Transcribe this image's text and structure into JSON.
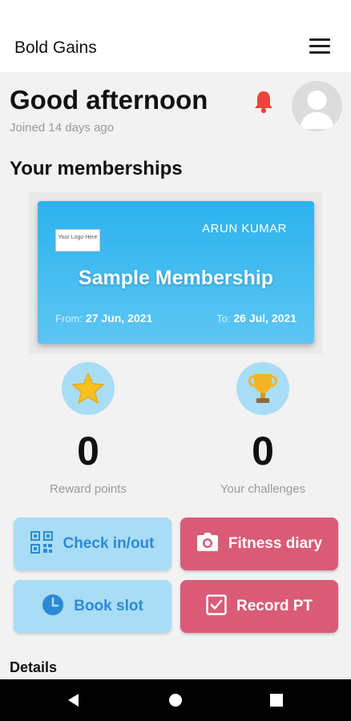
{
  "app": {
    "title": "Bold Gains"
  },
  "header": {
    "greeting": "Good afternoon",
    "joined": "Joined 14 days ago"
  },
  "memberships": {
    "section_title": "Your memberships",
    "card": {
      "logo_text": "Your Logo Here",
      "holder": "ARUN KUMAR",
      "plan": "Sample Membership",
      "from_label": "From:",
      "from_date": "27 Jun, 2021",
      "to_label": "To:",
      "to_date": "26 Jul, 2021"
    }
  },
  "stats": {
    "reward": {
      "value": "0",
      "label": "Reward points",
      "icon": "star-icon"
    },
    "challenges": {
      "value": "0",
      "label": "Your challenges",
      "icon": "trophy-icon"
    }
  },
  "actions": [
    {
      "label": "Check in/out",
      "icon": "qr-code-icon"
    },
    {
      "label": "Fitness diary",
      "icon": "camera-icon"
    },
    {
      "label": "Book slot",
      "icon": "clock-icon"
    },
    {
      "label": "Record PT",
      "icon": "checkbox-icon"
    }
  ],
  "details": {
    "title": "Details"
  },
  "colors": {
    "accent_blue": "#2bb3ee",
    "action_blue_bg": "#a9ddf5",
    "action_red_bg": "#da5b76",
    "bell": "#e8473b"
  }
}
